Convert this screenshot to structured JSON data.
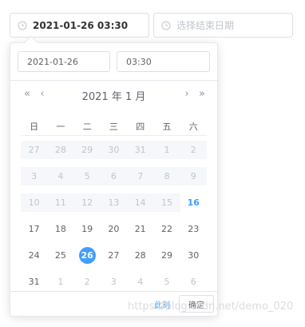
{
  "range": {
    "start_value": "2021-01-26 03:30",
    "end_placeholder": "选择结束日期"
  },
  "picker": {
    "date_input": "2021-01-26",
    "time_input": "03:30",
    "nav": {
      "prev_year": "«",
      "prev_month": "‹",
      "title": "2021 年  1 月",
      "next_month": "›",
      "next_year": "»"
    },
    "weekdays": [
      "日",
      "一",
      "二",
      "三",
      "四",
      "五",
      "六"
    ],
    "weeks": [
      [
        {
          "d": "27",
          "s": "disabled"
        },
        {
          "d": "28",
          "s": "disabled"
        },
        {
          "d": "29",
          "s": "disabled"
        },
        {
          "d": "30",
          "s": "disabled"
        },
        {
          "d": "31",
          "s": "disabled"
        },
        {
          "d": "1",
          "s": "disabled"
        },
        {
          "d": "2",
          "s": "disabled"
        }
      ],
      [
        {
          "d": "3",
          "s": "disabled"
        },
        {
          "d": "4",
          "s": "disabled"
        },
        {
          "d": "5",
          "s": "disabled"
        },
        {
          "d": "6",
          "s": "disabled"
        },
        {
          "d": "7",
          "s": "disabled"
        },
        {
          "d": "8",
          "s": "disabled"
        },
        {
          "d": "9",
          "s": "disabled"
        }
      ],
      [
        {
          "d": "10",
          "s": "disabled"
        },
        {
          "d": "11",
          "s": "disabled"
        },
        {
          "d": "12",
          "s": "disabled"
        },
        {
          "d": "13",
          "s": "disabled"
        },
        {
          "d": "14",
          "s": "disabled"
        },
        {
          "d": "15",
          "s": "disabled"
        },
        {
          "d": "16",
          "s": "today"
        }
      ],
      [
        {
          "d": "17",
          "s": "normal"
        },
        {
          "d": "18",
          "s": "normal"
        },
        {
          "d": "19",
          "s": "normal"
        },
        {
          "d": "20",
          "s": "normal"
        },
        {
          "d": "21",
          "s": "normal"
        },
        {
          "d": "22",
          "s": "normal"
        },
        {
          "d": "23",
          "s": "normal"
        }
      ],
      [
        {
          "d": "24",
          "s": "normal"
        },
        {
          "d": "25",
          "s": "normal"
        },
        {
          "d": "26",
          "s": "selected"
        },
        {
          "d": "27",
          "s": "normal"
        },
        {
          "d": "28",
          "s": "normal"
        },
        {
          "d": "29",
          "s": "normal"
        },
        {
          "d": "30",
          "s": "normal"
        }
      ],
      [
        {
          "d": "31",
          "s": "normal"
        },
        {
          "d": "1",
          "s": "other"
        },
        {
          "d": "2",
          "s": "other"
        },
        {
          "d": "3",
          "s": "other"
        },
        {
          "d": "4",
          "s": "other"
        },
        {
          "d": "5",
          "s": "other"
        },
        {
          "d": "6",
          "s": "other"
        }
      ]
    ],
    "footer": {
      "now_label": "此刻",
      "ok_label": "确定"
    }
  },
  "watermark": "https://blog.csdn.net/demo_020",
  "colors": {
    "accent": "#409eff",
    "border": "#dcdfe6",
    "disabled_bg": "#f5f7fa",
    "disabled_text": "#c0c4cc"
  },
  "icons": {
    "range_start": "clock-icon",
    "range_end": "clock-icon"
  }
}
